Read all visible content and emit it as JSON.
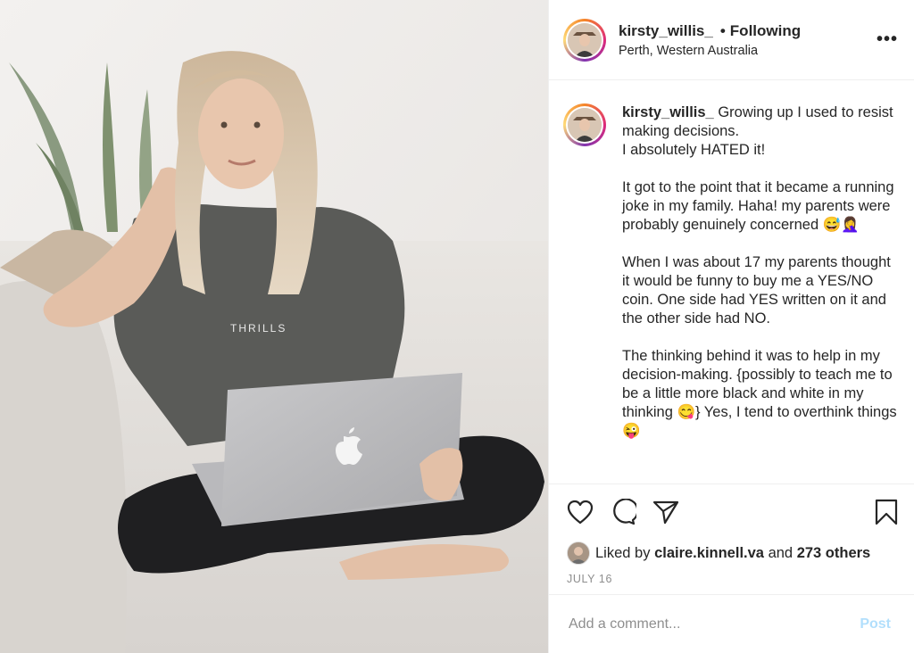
{
  "post": {
    "photo": {
      "shirt_text": "THRILLS"
    },
    "header": {
      "username": "kirsty_willis_",
      "separator": "•",
      "follow_status": "Following",
      "location": "Perth, Western Australia",
      "more_label": "•••"
    },
    "caption": {
      "username": "kirsty_willis_",
      "text": " Growing up I used to resist making decisions.\nI absolutely HATED it!\n\nIt got to the point that it became a running joke in my family. Haha! my parents were probably genuinely concerned 😅🤦‍♀️\n\nWhen I was about 17 my parents thought it would be funny to buy me a YES/NO coin. One side had YES written on it and the other side had NO.\n\nThe thinking behind it was to help in my decision-making. {possibly to teach me to be a little more black and white in my thinking 😋} Yes, I tend to overthink things 😜"
    },
    "actions": {
      "like_icon": "heart-icon",
      "comment_icon": "comment-icon",
      "share_icon": "paper-plane-icon",
      "save_icon": "bookmark-icon"
    },
    "likes": {
      "prefix": "Liked by ",
      "liker": "claire.kinnell.va",
      "middle": " and ",
      "others": "273 others"
    },
    "date": "JULY 16",
    "comment": {
      "placeholder": "Add a comment...",
      "post_label": "Post"
    },
    "colors": {
      "post_button": "#b2dffc",
      "secondary_text": "#8e8e8e"
    }
  }
}
